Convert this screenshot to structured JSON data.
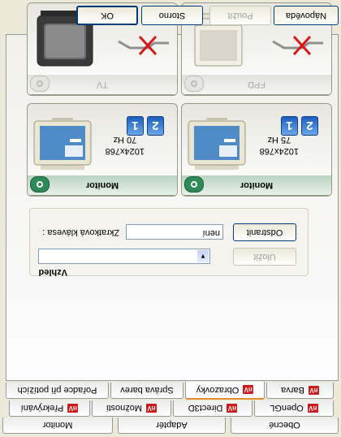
{
  "dialog_buttons": {
    "ok": "OK",
    "cancel": "Storno",
    "apply": "Použít",
    "help": "Nápověda"
  },
  "tabs": {
    "row1": [
      "Obecné",
      "Adaptér",
      "Monitor"
    ],
    "row2": [
      "OpenGL",
      "Direct3D",
      "Možnosti",
      "Překrývání"
    ],
    "row3": [
      "Pořadce při potížích",
      "Správa barev",
      "Obrazovky",
      "Barva"
    ],
    "active": "Obrazovky"
  },
  "settings": {
    "label_appearance": "Vzhled",
    "label_hotkey": "Zkratková klávesa :",
    "hotkey_value": "není",
    "appearance_value": "",
    "save_button": "Uložit",
    "remove_button": "Odstranit"
  },
  "displays": {
    "monitor1": {
      "label": "Monitor",
      "resolution": "1024x768",
      "refresh": "70 Hz",
      "num1": "1",
      "num2": "2"
    },
    "monitor2": {
      "label": "Monitor",
      "resolution": "1024x768",
      "refresh": "75 Hz",
      "num1": "1",
      "num2": "2"
    },
    "tv": {
      "label": "TV"
    },
    "fpd": {
      "label": "FPD"
    }
  }
}
